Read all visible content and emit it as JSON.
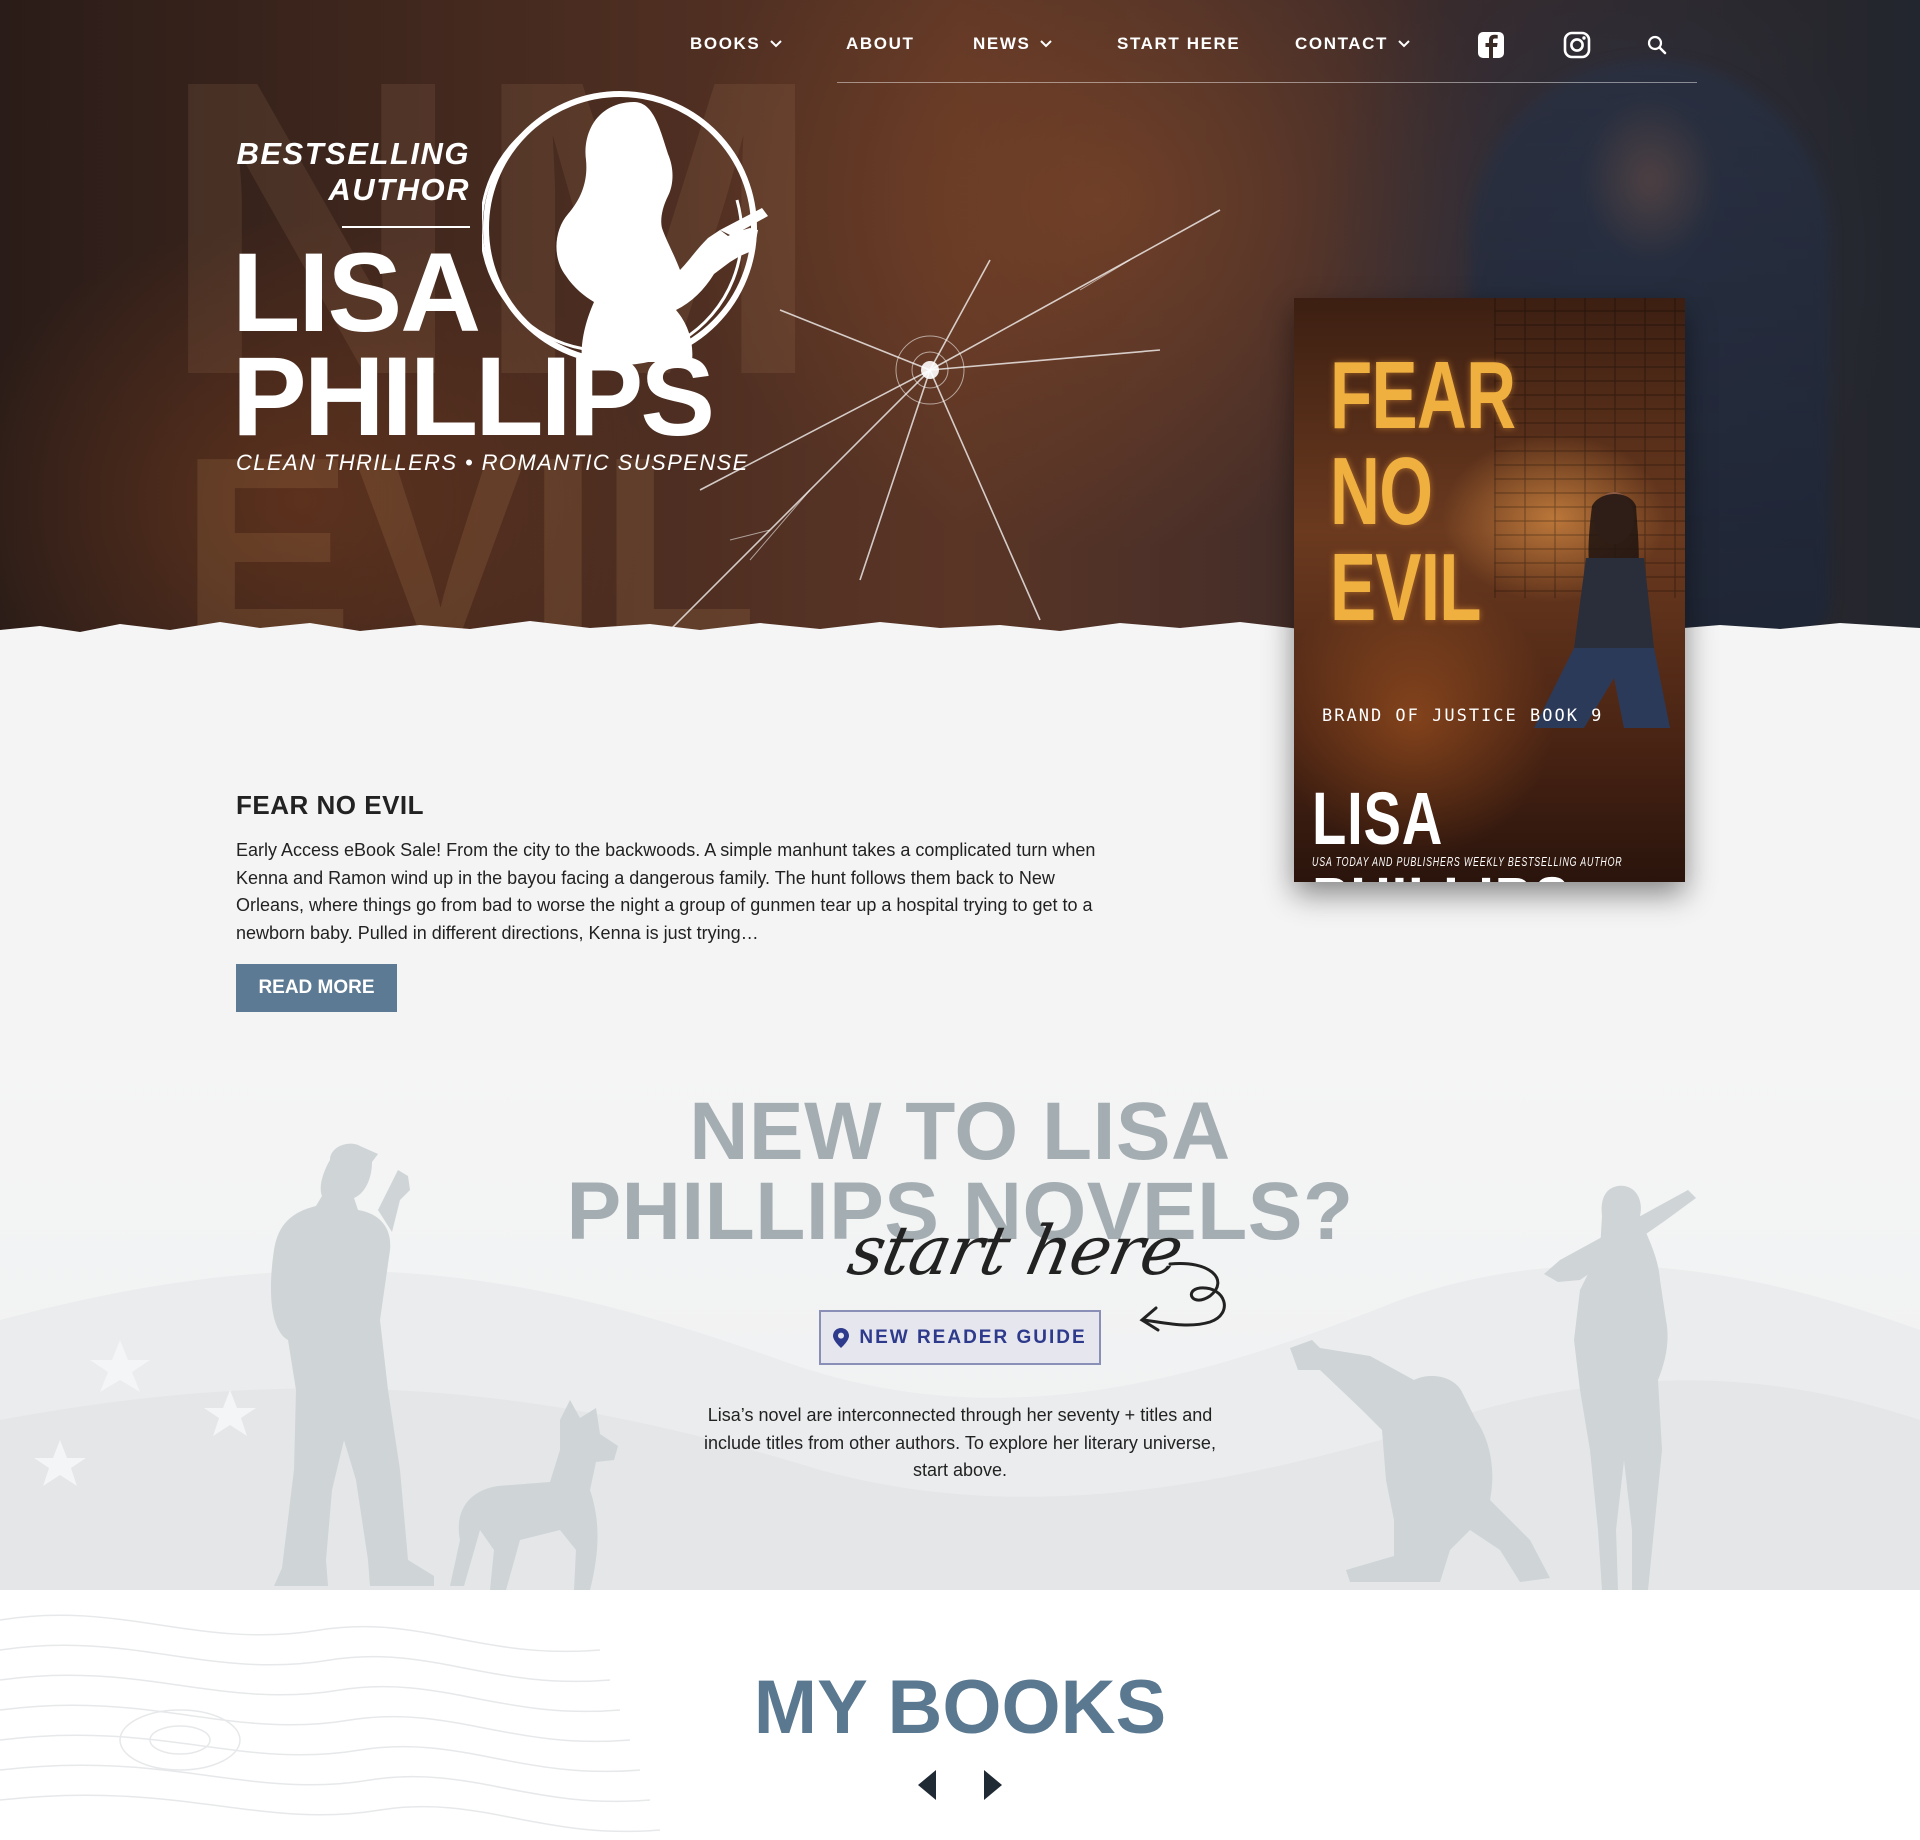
{
  "nav": {
    "items": [
      {
        "label": "BOOKS",
        "dropdown": true
      },
      {
        "label": "ABOUT",
        "dropdown": false
      },
      {
        "label": "NEWS",
        "dropdown": true
      },
      {
        "label": "START HERE",
        "dropdown": false
      },
      {
        "label": "CONTACT",
        "dropdown": true
      }
    ],
    "icons": [
      "facebook-icon",
      "instagram-icon",
      "search-icon"
    ]
  },
  "logo": {
    "line1": "BESTSELLING",
    "line2": "AUTHOR",
    "first_name": "LISA",
    "last_name": "PHILLIPS",
    "tagline": "CLEAN THRILLERS • ROMANTIC SUSPENSE"
  },
  "featured_book": {
    "cover_title_lines": [
      "FEAR",
      "NO",
      "EVIL"
    ],
    "cover_series": "BRAND OF JUSTICE BOOK 9",
    "cover_author": "LISA PHILLIPS",
    "cover_tagline": "USA TODAY AND PUBLISHERS WEEKLY BESTSELLING AUTHOR",
    "title": "FEAR NO EVIL",
    "description": "Early Access eBook Sale! From the city to the backwoods. A simple manhunt takes a complicated turn when Kenna and Ramon wind up in the bayou facing a dangerous family. The hunt follows them back to New Orleans, where things go from bad to worse the night a group of gunmen tear up a hospital trying to get to a newborn baby. Pulled in different directions, Kenna is just trying…",
    "button_label": "READ MORE"
  },
  "new_reader": {
    "heading_line1": "NEW TO LISA",
    "heading_line2": "PHILLIPS NOVELS?",
    "script": "start here",
    "button_label": "NEW READER GUIDE",
    "text": "Lisa’s novel are interconnected through her seventy + titles and include titles from other authors. To explore her literary universe, start above."
  },
  "my_books": {
    "title": "MY BOOKS"
  },
  "colors": {
    "button_blue": "#5c7a94",
    "heading_gray": "#a4aeb2",
    "guide_blue": "#2e3a8c",
    "mybooks_title": "#5a7890"
  }
}
